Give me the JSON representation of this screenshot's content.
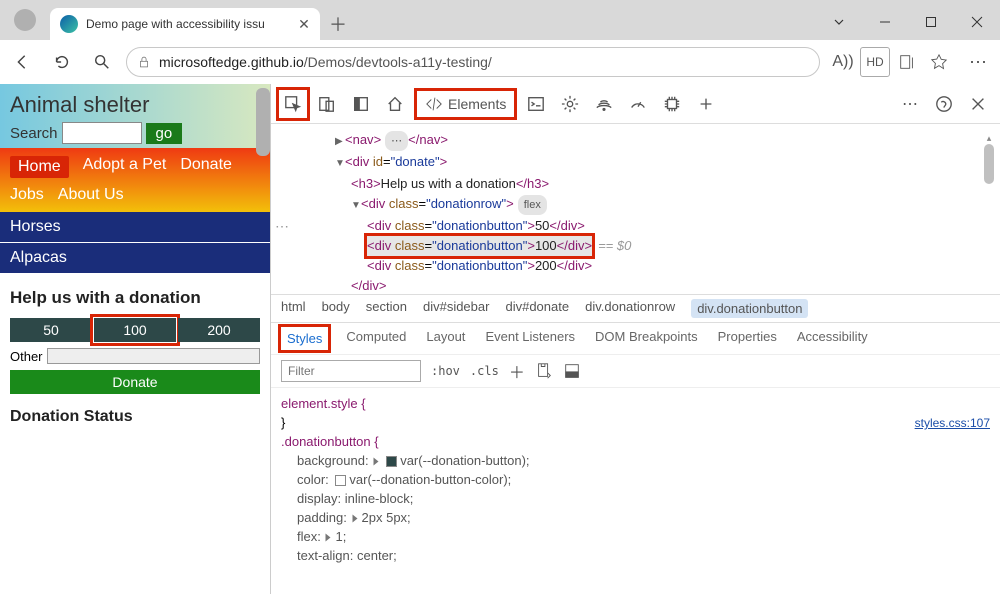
{
  "tab": {
    "title": "Demo page with accessibility issu"
  },
  "url": {
    "host": "microsoftedge.github.io",
    "path": "/Demos/devtools-a11y-testing/"
  },
  "addr_icons": {
    "read_aloud": "A))",
    "hd": "HD"
  },
  "demo": {
    "title": "Animal shelter",
    "search_label": "Search",
    "go": "go",
    "nav": [
      "Home",
      "Adopt a Pet",
      "Donate",
      "Jobs",
      "About Us"
    ],
    "animals": [
      "Horses",
      "Alpacas"
    ],
    "donate_h": "Help us with a donation",
    "buttons": [
      "50",
      "100",
      "200"
    ],
    "other": "Other",
    "donate_btn": "Donate",
    "status_h": "Donation Status"
  },
  "devtools": {
    "elements_label": "Elements",
    "dom": {
      "nav_open": "nav",
      "nav_close": "nav",
      "div_donate_open": "div",
      "div_donate_id": "donate",
      "h3_open": "h3",
      "h3_text": "Help us with a donation",
      "h3_close": "h3",
      "row_open": "div",
      "row_class": "donationrow",
      "flex": "flex",
      "btn_class": "donationbutton",
      "btn50": "50",
      "btn100": "100",
      "btn200": "200",
      "div_close": "div",
      "eq": "== $0"
    },
    "crumbs": [
      "html",
      "body",
      "section",
      "div#sidebar",
      "div#donate",
      "div.donationrow",
      "div.donationbutton"
    ],
    "panel_tabs": [
      "Styles",
      "Computed",
      "Layout",
      "Event Listeners",
      "DOM Breakpoints",
      "Properties",
      "Accessibility"
    ],
    "filter_placeholder": "Filter",
    "hov": ":hov",
    "cls": ".cls",
    "styles": {
      "element_style": "element.style {",
      "brace": "}",
      "rule_sel": ".donationbutton {",
      "link": "styles.css:107",
      "p1n": "background:",
      "p1v": "var(--donation-button);",
      "p2n": "color:",
      "p2v": "var(--donation-button-color);",
      "p3n": "display:",
      "p3v": "inline-block;",
      "p4n": "padding:",
      "p4v": "2px 5px;",
      "p5n": "flex:",
      "p5v": "1;",
      "p6n": "text-align:",
      "p6v": "center;"
    }
  }
}
